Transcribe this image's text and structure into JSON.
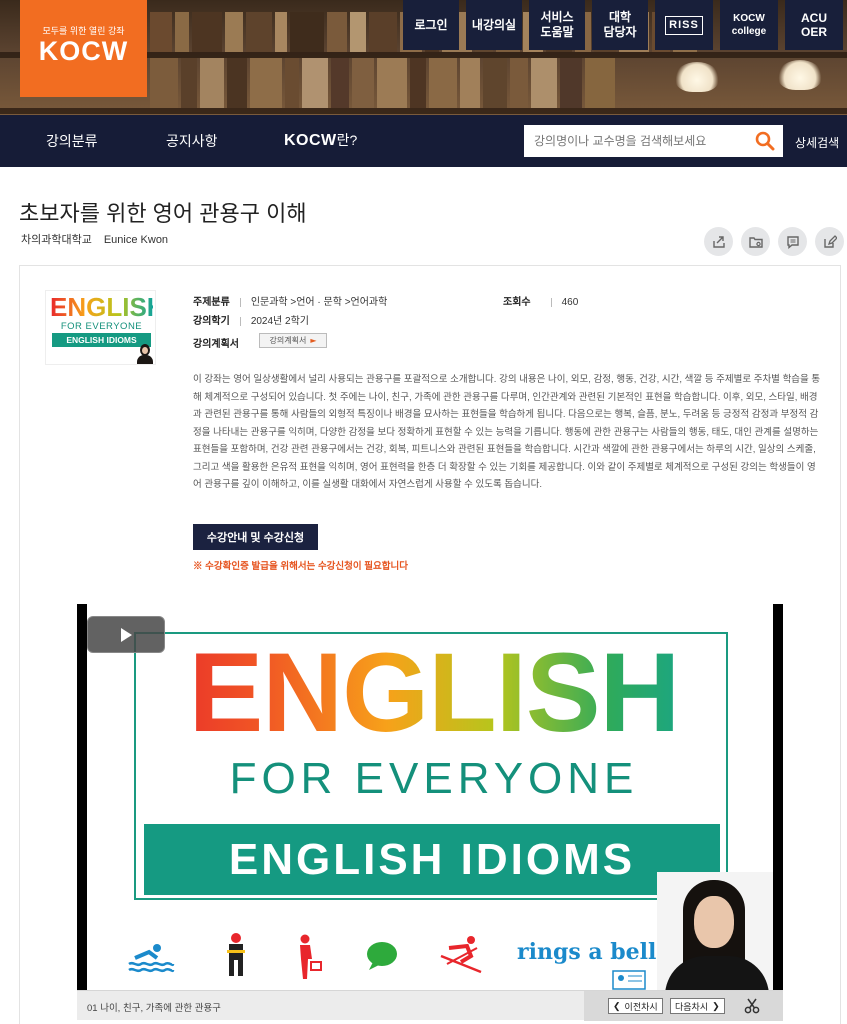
{
  "header": {
    "logo_tagline": "모두를 위한 열린 강좌",
    "logo_text": "KOCW",
    "top_buttons": [
      {
        "label": "로그인"
      },
      {
        "label": "내강의실"
      },
      {
        "label": "서비스\n도움말"
      },
      {
        "label": "대학\n담당자"
      },
      {
        "label": "RISS"
      },
      {
        "label": "KOCW\ncollege"
      },
      {
        "label": "ACU\nOER"
      }
    ]
  },
  "nav": {
    "items": [
      {
        "label": "강의분류"
      },
      {
        "label": "공지사항"
      },
      {
        "label_brand": "KOCW",
        "label_suffix": "란?"
      }
    ],
    "search_placeholder": "강의명이나 교수명을 검색해보세요",
    "advanced_search": "상세검색"
  },
  "course": {
    "title": "초보자를 위한 영어 관용구 이해",
    "university": "차의과학대학교",
    "instructor": "Eunice Kwon",
    "subject_label": "주제분류",
    "subject_value": "인문과학 >언어 · 문학 >언어과학",
    "views_label": "조회수",
    "views_value": "460",
    "term_label": "강의학기",
    "term_value": "2024년 2학기",
    "plan_label": "강의계획서",
    "plan_button": "강의계획서",
    "description": "이 강좌는 영어 일상생활에서 널리 사용되는 관용구를 포괄적으로 소개합니다. 강의 내용은 나이, 외모, 감정, 행동, 건강, 시간, 색깔 등 주제별로 주차별 학습을 통해 체계적으로 구성되어 있습니다. 첫 주에는 나이, 친구, 가족에 관한 관용구를 다루며, 인간관계와 관련된 기본적인 표현을 학습합니다. 이후, 외모, 스타일, 배경과 관련된 관용구를 통해 사람들의 외형적 특징이나 배경을 묘사하는 표현들을 학습하게 됩니다. 다음으로는 행복, 슬픔, 분노, 두려움 등 긍정적 감정과 부정적 감정을 나타내는 관용구를 익히며, 다양한 감정을 보다 정확하게 표현할 수 있는 능력을 기릅니다. 행동에 관한 관용구는 사람들의 행동, 태도, 대인 관계를 설명하는 표현들을 포함하며, 건강 관련 관용구에서는 건강, 회복, 피트니스와 관련된 표현들을 학습합니다. 시간과 색깔에 관한 관용구에서는 하루의 시간, 일상의 스케줄, 그리고 색을 활용한 은유적 표현을 익히며, 영어 표현력을 한층 더 확장할 수 있는 기회를 제공합니다. 이와 같이 주제별로 체계적으로 구성된 강의는 학생들이 영어 관용구를 깊이 이해하고, 이를 실생활 대화에서 자연스럽게 사용할 수 있도록 돕습니다.",
    "enroll_button": "수강안내 및 수강신청",
    "enroll_notice": "※ 수강확인증 발급을 위해서는 수강신청이 필요합니다"
  },
  "thumbnail": {
    "line1": "ENGLISH",
    "line2": "FOR EVERYONE",
    "line3": "ENGLISH IDIOMS"
  },
  "video": {
    "cover_title": "ENGLISH",
    "cover_subtitle": "FOR EVERYONE",
    "cover_band": "ENGLISH IDIOMS",
    "cover_caption": "rings a bell",
    "current_lecture": "01 나이, 친구, 가족에 관한 관용구",
    "prev_label": "이전차시",
    "next_label": "다음차시"
  },
  "colors": {
    "brand_orange": "#f26d21",
    "navy": "#161c37",
    "teal": "#159a82",
    "notice": "#e6541f"
  }
}
